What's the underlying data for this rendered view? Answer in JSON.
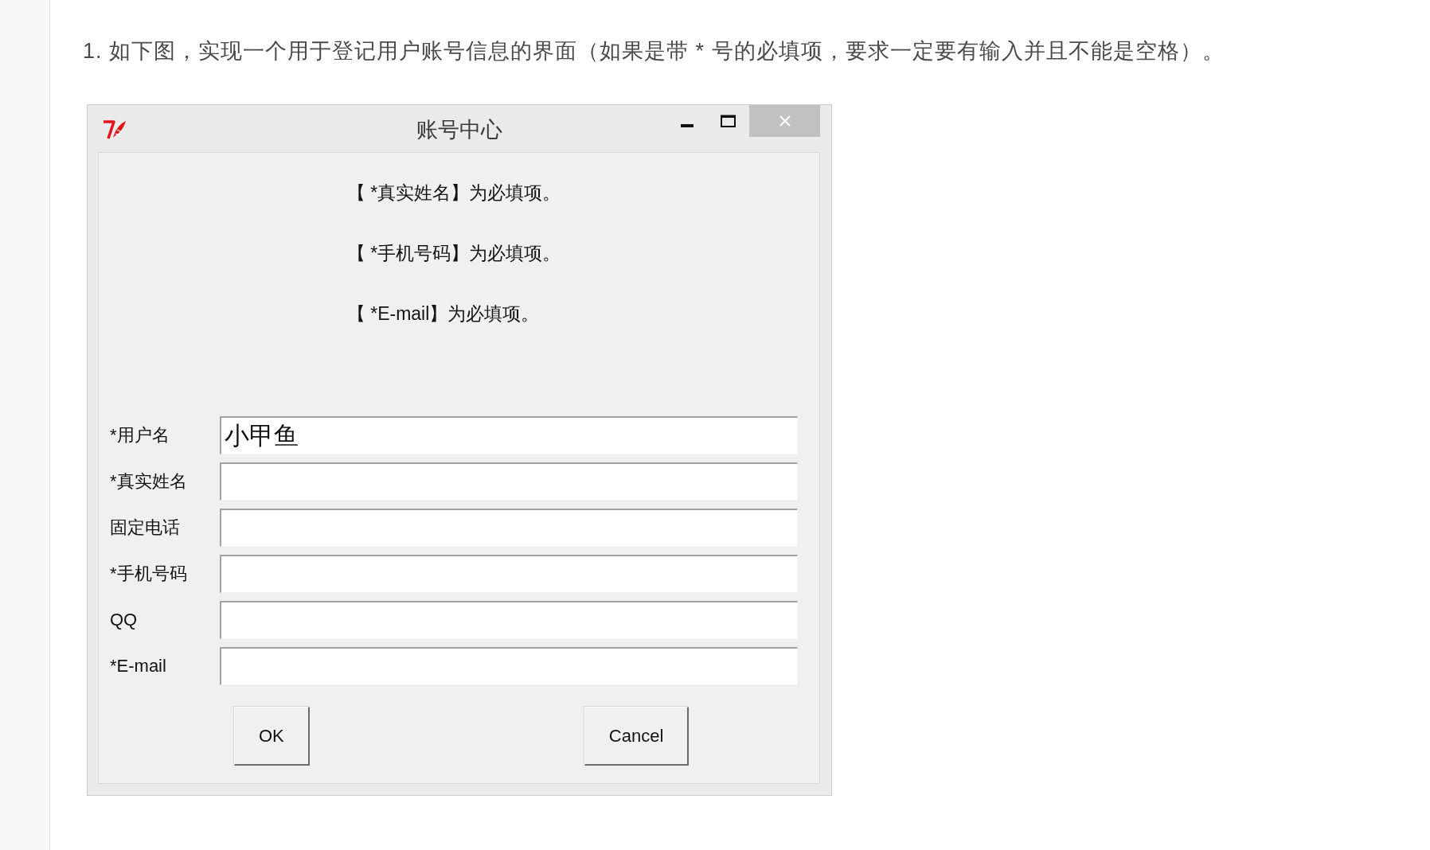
{
  "intro": "1. 如下图，实现一个用于登记用户账号信息的界面（如果是带 * 号的必填项，要求一定要有输入并且不能是空格）。",
  "window": {
    "title": "账号中心",
    "notices": [
      "【 *真实姓名】为必填项。",
      "【 *手机号码】为必填项。",
      "【 *E-mail】为必填项。"
    ],
    "fields": [
      {
        "label": "*用户名",
        "value": "小甲鱼"
      },
      {
        "label": "*真实姓名"
      },
      {
        "label": "固定电话"
      },
      {
        "label": "*手机号码"
      },
      {
        "label": "QQ"
      },
      {
        "label": "*E-mail"
      }
    ],
    "buttons": [
      "OK",
      "Cancel"
    ]
  }
}
